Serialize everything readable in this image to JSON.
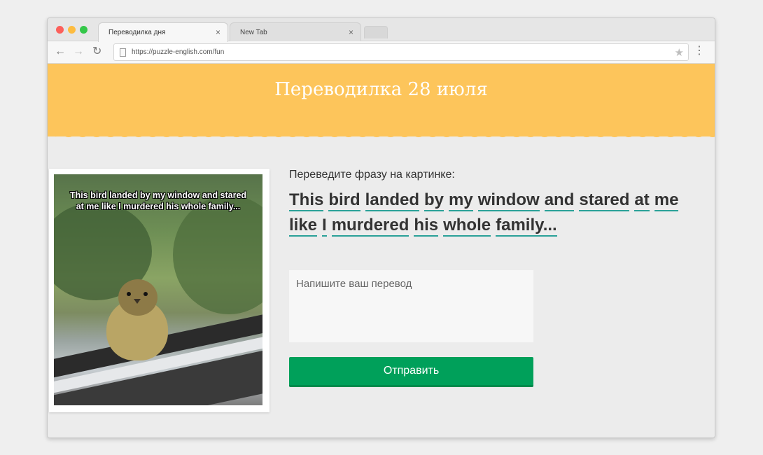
{
  "browser": {
    "tabs": [
      {
        "label": "Переводилка дня",
        "active": true
      },
      {
        "label": "New Tab",
        "active": false
      }
    ],
    "close_glyph": "×",
    "url": "https://puzzle-english.com/fun",
    "icons": {
      "back": "arrow-left-icon",
      "forward": "arrow-right-icon",
      "reload": "reload-icon",
      "bookmark": "star-icon",
      "menu": "vertical-dots-icon"
    }
  },
  "banner": {
    "title": "Переводилка 28 июля",
    "color": "#fdc55b"
  },
  "photo": {
    "caption": "This bird landed by my window and stared at me like I murdered his whole family..."
  },
  "exercise": {
    "instruction": "Переведите фразу на картинке:",
    "words": [
      "This",
      "bird",
      "landed",
      "by",
      "my",
      "window",
      "and",
      "stared",
      "at",
      "me",
      "like",
      "I",
      "murdered",
      "his",
      "whole",
      "family..."
    ],
    "underline_color": "#2aa198"
  },
  "form": {
    "placeholder": "Напишите ваш перевод",
    "submit_label": "Отправить",
    "submit_color": "#00a05a"
  }
}
